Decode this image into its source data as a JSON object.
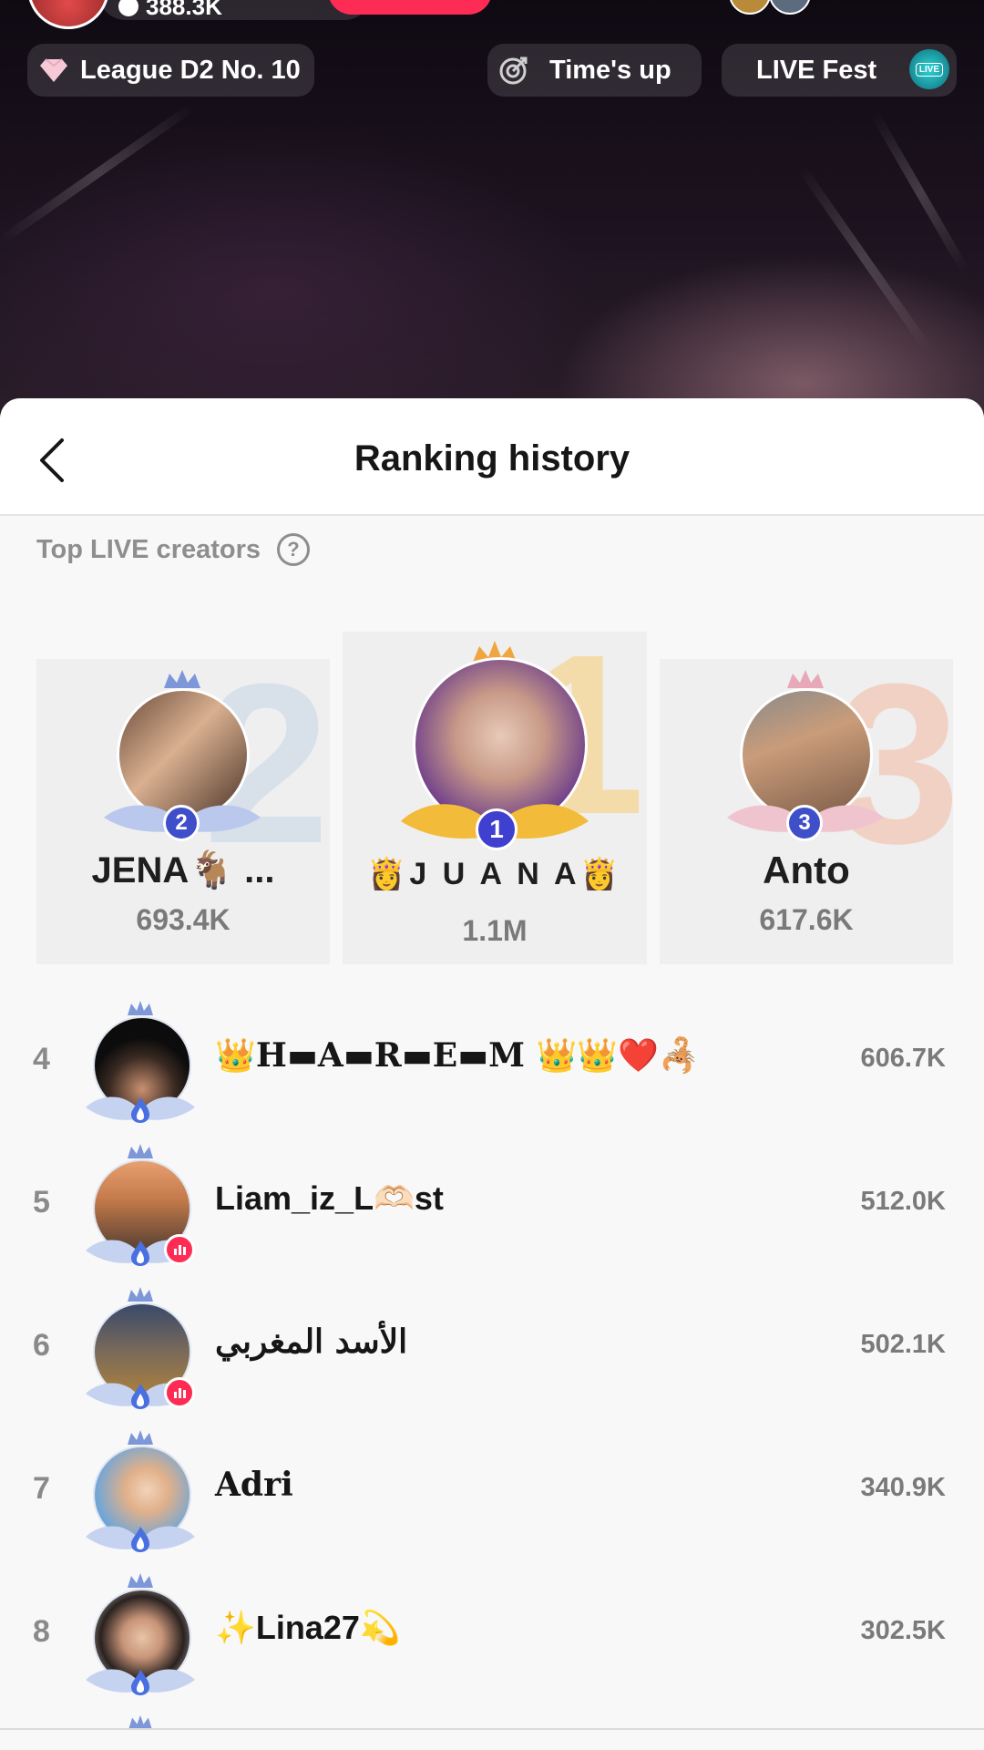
{
  "stream": {
    "viewer_count": "388.3K",
    "league_label": "League D2 No. 10",
    "timer_label": "Time's up",
    "fest_label": "LIVE Fest",
    "fest_badge": "LIVE"
  },
  "sheet": {
    "title": "Ranking history",
    "section_title": "Top LIVE creators",
    "help_glyph": "?"
  },
  "podium": [
    {
      "rank_big": "2",
      "rank": "2",
      "name": "JENA🐐 ...",
      "score": "693.4K"
    },
    {
      "rank_big": "1",
      "rank": "1",
      "name": "👸J U A N A👸",
      "score": "1.1M"
    },
    {
      "rank_big": "3",
      "rank": "3",
      "name": "Anto",
      "score": "617.6K"
    }
  ],
  "rows": [
    {
      "rank": "4",
      "name": "👑H▬A▬R▬E▬M 👑👑❤️🦂",
      "score": "606.7K",
      "live": false
    },
    {
      "rank": "5",
      "name": "Liam_iz_L🫶🏻st",
      "score": "512.0K",
      "live": true
    },
    {
      "rank": "6",
      "name": "الأسد المغربي",
      "score": "502.1K",
      "live": true
    },
    {
      "rank": "7",
      "name": "Adri",
      "score": "340.9K",
      "live": false
    },
    {
      "rank": "8",
      "name": "✨Lina27💫",
      "score": "302.5K",
      "live": false
    }
  ],
  "colors": {
    "accent_pink": "#fe2c55",
    "rank_badge_blue": "#3f4fc9",
    "gold": "#f3dcaa",
    "silver": "#d8e1ea",
    "bronze": "#f1d1c3"
  },
  "icons": {
    "back": "chevron-left-icon",
    "help": "question-circle-icon",
    "league": "diamond-icon",
    "timer": "target-icon"
  }
}
